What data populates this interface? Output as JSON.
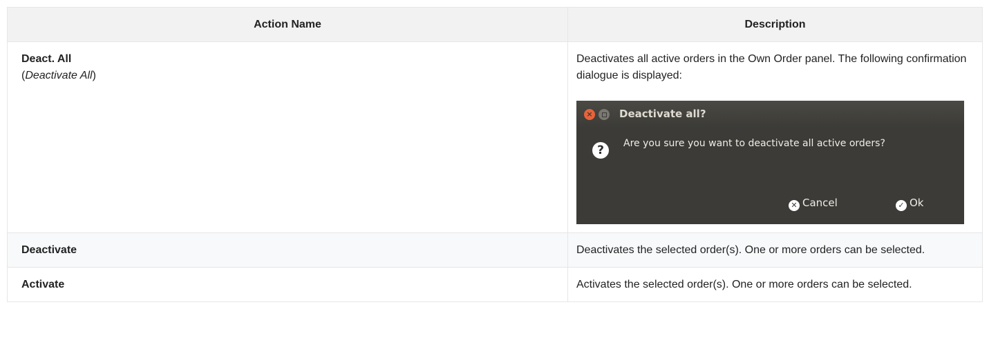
{
  "table": {
    "headers": [
      "Action Name",
      "Description"
    ],
    "rows": [
      {
        "name": "Deact. All",
        "full_name_open": "(",
        "full_name": "Deactivate All",
        "full_name_close": ")",
        "description": "Deactivates all active orders in the Own Order panel. The following confirmation dialogue is displayed:"
      },
      {
        "name": "Deactivate",
        "description": "Deactivates the selected order(s). One or more orders can be selected."
      },
      {
        "name": "Activate",
        "description": "Activates the selected order(s). One or more orders can be selected."
      }
    ]
  },
  "dialog": {
    "title": "Deactivate all?",
    "message": "Are you sure you want to deactivate all active orders?",
    "cancel_label": "Cancel",
    "ok_label": "Ok",
    "icons": {
      "close": "close-icon",
      "maximize": "maximize-icon",
      "question": "question-icon",
      "cancel": "x-circle-icon",
      "ok": "check-circle-icon"
    },
    "colors": {
      "background": "#3c3b37",
      "close_button": "#e8633a"
    }
  }
}
